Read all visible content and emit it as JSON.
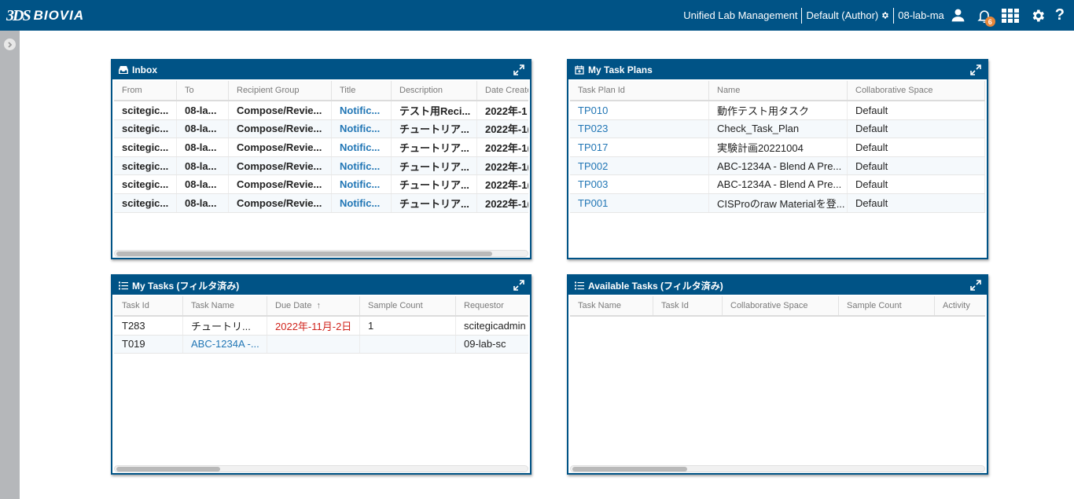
{
  "header": {
    "logo_mark": "3DS",
    "logo_text": "BIOVIA",
    "app_name": "Unified Lab Management",
    "role": "Default (Author)",
    "user": "08-lab-ma",
    "notification_count": "6"
  },
  "inbox": {
    "title": "Inbox",
    "columns": [
      "From",
      "To",
      "Recipient Group",
      "Title",
      "Description",
      "Date Create"
    ],
    "rows": [
      [
        "scitegic...",
        "08-la...",
        "Compose/Revie...",
        "Notific...",
        "テスト用Reci...",
        "2022年-1"
      ],
      [
        "scitegic...",
        "08-la...",
        "Compose/Revie...",
        "Notific...",
        "チュートリア...",
        "2022年-1("
      ],
      [
        "scitegic...",
        "08-la...",
        "Compose/Revie...",
        "Notific...",
        "チュートリア...",
        "2022年-1("
      ],
      [
        "scitegic...",
        "08-la...",
        "Compose/Revie...",
        "Notific...",
        "チュートリア...",
        "2022年-1("
      ],
      [
        "scitegic...",
        "08-la...",
        "Compose/Revie...",
        "Notific...",
        "チュートリア...",
        "2022年-1("
      ],
      [
        "scitegic...",
        "08-la...",
        "Compose/Revie...",
        "Notific...",
        "チュートリア...",
        "2022年-1("
      ]
    ]
  },
  "task_plans": {
    "title": "My Task Plans",
    "columns": [
      "Task Plan Id",
      "Name",
      "Collaborative Space"
    ],
    "rows": [
      [
        "TP010",
        "動作テスト用タスク",
        "Default"
      ],
      [
        "TP023",
        "Check_Task_Plan",
        "Default"
      ],
      [
        "TP017",
        "実験計画20221004",
        "Default"
      ],
      [
        "TP002",
        "ABC-1234A - Blend A Pre...",
        "Default"
      ],
      [
        "TP003",
        "ABC-1234A - Blend A Pre...",
        "Default"
      ],
      [
        "TP001",
        "CISProのraw Materialを登...",
        "Default"
      ]
    ]
  },
  "my_tasks": {
    "title": "My Tasks (フィルタ済み)",
    "columns": [
      "Task Id",
      "Task Name",
      "Due Date",
      "Sample Count",
      "Requestor"
    ],
    "sort_indicator": "↑",
    "rows": [
      [
        "T283",
        "チュートリ...",
        "2022年-11月-2日",
        "1",
        "scitegicadmin"
      ],
      [
        "T019",
        "ABC-1234A -...",
        "",
        "",
        "09-lab-sc"
      ]
    ]
  },
  "available_tasks": {
    "title": "Available Tasks (フィルタ済み)",
    "columns": [
      "Task Name",
      "Task Id",
      "Collaborative Space",
      "Sample Count",
      "Activity"
    ]
  },
  "colors": {
    "brand": "#005386",
    "link": "#2176b5",
    "overdue": "#d0231b",
    "badge": "#e6863a"
  }
}
